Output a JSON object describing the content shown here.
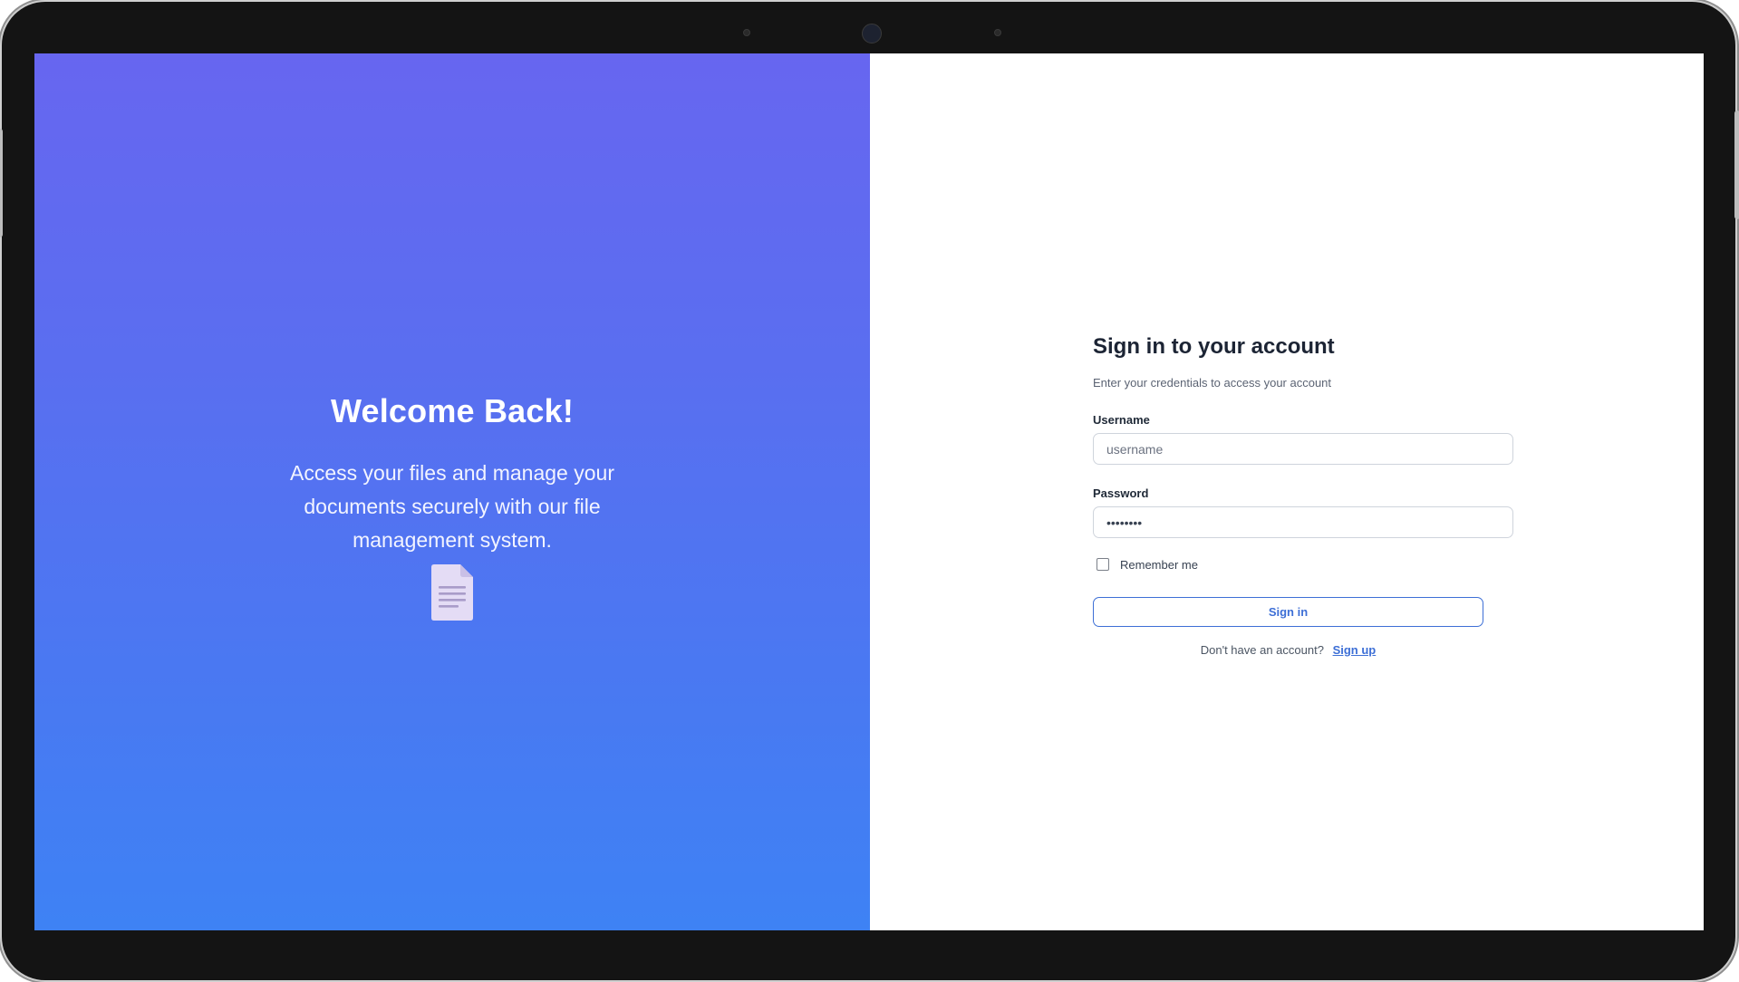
{
  "hero": {
    "title": "Welcome Back!",
    "subtitle": "Access your files and manage your documents securely with our file management system.",
    "icon": "document-icon"
  },
  "login": {
    "title": "Sign in to your account",
    "subtitle": "Enter your credentials to access your account",
    "username_label": "Username",
    "username_placeholder": "username",
    "username_value": "",
    "password_label": "Password",
    "password_value": "password",
    "remember_label": "Remember me",
    "remember_checked": false,
    "submit_label": "Sign in",
    "signup_prompt": "Don't have an account?",
    "signup_link": "Sign up"
  },
  "colors": {
    "gradient_top": "#6766f0",
    "gradient_bottom": "#3e82f4",
    "accent": "#3d6fd6",
    "heading": "#1c2434"
  }
}
